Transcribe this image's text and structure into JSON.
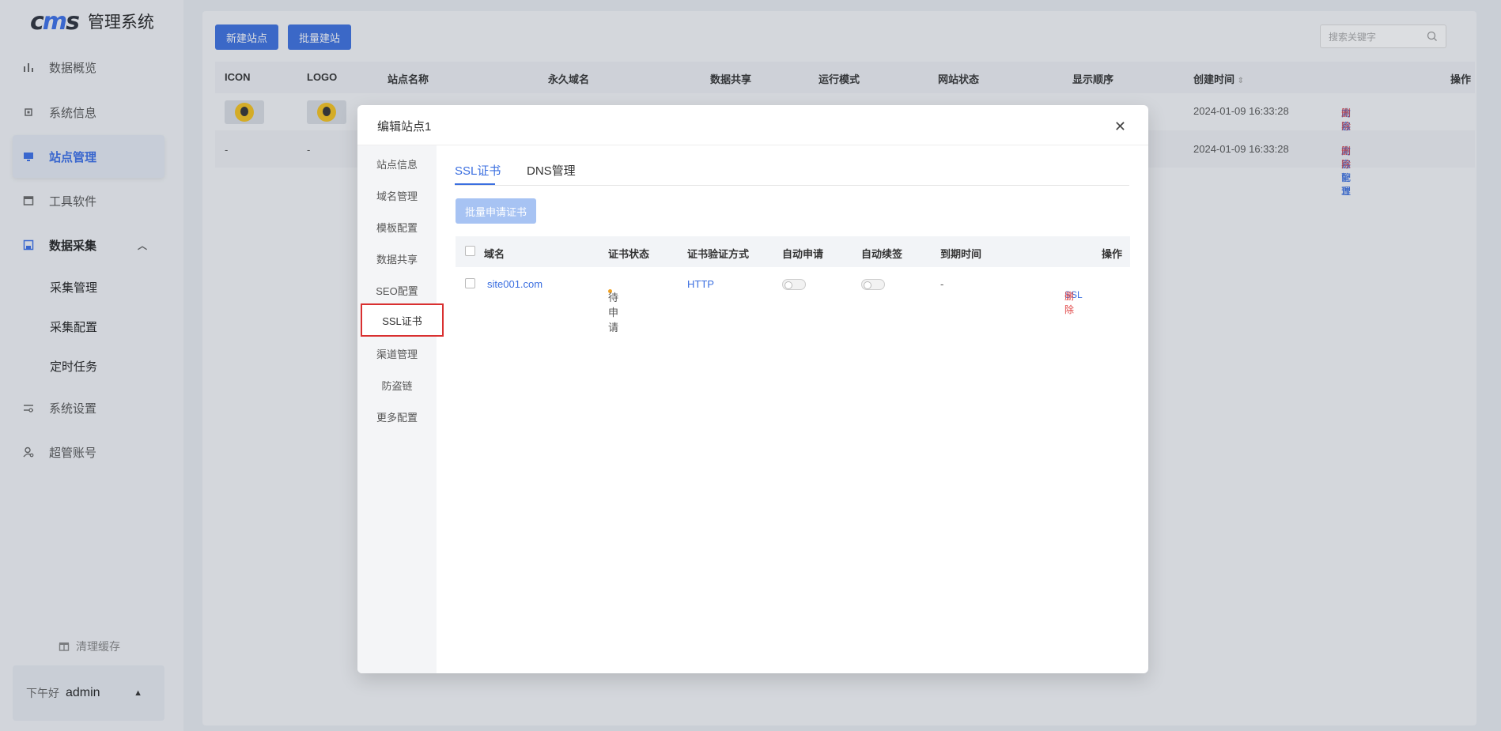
{
  "sidebar": {
    "logo_mark_a": "c",
    "logo_mark_b": "m",
    "logo_mark_c": "s",
    "logo_text": "管理系统",
    "items": [
      {
        "label": "数据概览",
        "icon": "bar-chart-icon"
      },
      {
        "label": "系统信息",
        "icon": "chip-icon"
      },
      {
        "label": "站点管理",
        "icon": "monitor-icon"
      },
      {
        "label": "工具软件",
        "icon": "window-icon"
      },
      {
        "label": "数据采集",
        "icon": "save-icon"
      },
      {
        "label": "系统设置",
        "icon": "settings-sliders-icon"
      },
      {
        "label": "超管账号",
        "icon": "user-gear-icon"
      }
    ],
    "sub_items": [
      "采集管理",
      "采集配置",
      "定时任务"
    ],
    "clear_cache": "清理缓存",
    "greeting": "下午好",
    "username": "admin"
  },
  "toolbar": {
    "new_site": "新建站点",
    "batch_site": "批量建站",
    "search_placeholder": "搜索关键字"
  },
  "table": {
    "headers": [
      "ICON",
      "LOGO",
      "站点名称",
      "永久域名",
      "数据共享",
      "运行模式",
      "网站状态",
      "显示顺序",
      "创建时间",
      "操作"
    ],
    "rows": [
      {
        "icon": "",
        "logo": "",
        "created": "2024-01-09 16:33:28",
        "act1": "内容管理",
        "act2": "站点配置",
        "act3": "删除"
      },
      {
        "icon": "-",
        "logo": "-",
        "created": "2024-01-09 16:33:28",
        "act1": "内容管理",
        "act2": "站点配置",
        "act3": "删除"
      }
    ]
  },
  "modal": {
    "title": "编辑站点1",
    "side_tabs": [
      "站点信息",
      "域名管理",
      "模板配置",
      "数据共享",
      "SEO配置",
      "SSL证书",
      "渠道管理",
      "防盗链",
      "更多配置"
    ],
    "tabs": [
      "SSL证书",
      "DNS管理"
    ],
    "batch_apply": "批量申请证书",
    "ssl_headers": [
      "域名",
      "证书状态",
      "证书验证方式",
      "自动申请",
      "自动续签",
      "到期时间",
      "操作"
    ],
    "ssl_row": {
      "domain": "site001.com",
      "status": "待申请",
      "method": "HTTP",
      "auto_apply": false,
      "auto_renew": false,
      "expire": "-",
      "act_ssl": "SSL",
      "act_delete": "删除"
    }
  }
}
